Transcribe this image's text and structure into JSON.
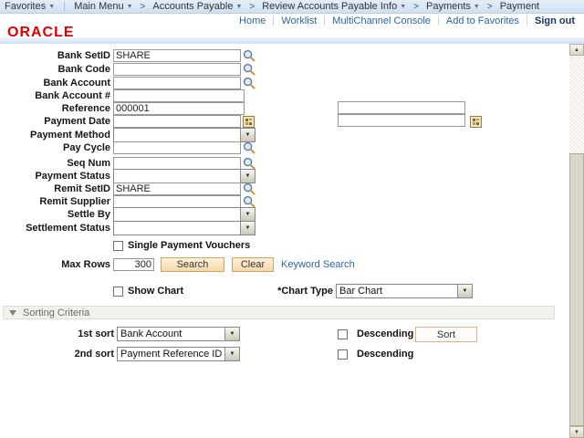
{
  "chrome": {
    "breadcrumb": {
      "favorites": "Favorites",
      "main_menu": "Main Menu",
      "separator": ">",
      "trail": [
        "Accounts Payable",
        "Review Accounts Payable Info",
        "Payments",
        "Payment"
      ]
    },
    "links": {
      "home": "Home",
      "worklist": "Worklist",
      "multichannel": "MultiChannel Console",
      "add_to_favorites": "Add to Favorites",
      "sign_out": "Sign out"
    },
    "logo": "ORACLE",
    "colors": {
      "logo_red": "#e00000",
      "link_blue": "#2d64a0",
      "button_tan": "#f6d9a9",
      "topbar_blue": "#d7e5f3"
    }
  },
  "form": {
    "bank_setid": {
      "label": "Bank SetID",
      "value": "SHARE"
    },
    "bank_code": {
      "label": "Bank Code",
      "value": ""
    },
    "bank_account": {
      "label": "Bank Account",
      "value": ""
    },
    "bank_account_num": {
      "label": "Bank Account #",
      "value": ""
    },
    "reference": {
      "label": "Reference",
      "value": "000001",
      "to_value": ""
    },
    "payment_date": {
      "label": "Payment Date",
      "value": "",
      "to_value": ""
    },
    "payment_method": {
      "label": "Payment Method",
      "value": ""
    },
    "pay_cycle": {
      "label": "Pay Cycle",
      "value": ""
    },
    "seq_num": {
      "label": "Seq Num",
      "value": ""
    },
    "payment_status": {
      "label": "Payment Status",
      "value": ""
    },
    "remit_setid": {
      "label": "Remit SetID",
      "value": "SHARE"
    },
    "remit_supplier": {
      "label": "Remit Supplier",
      "value": ""
    },
    "settle_by": {
      "label": "Settle By",
      "value": ""
    },
    "settlement_status": {
      "label": "Settlement Status",
      "value": ""
    },
    "single_payment_vouchers": {
      "label": "Single Payment Vouchers",
      "checked": false
    },
    "max_rows": {
      "label": "Max Rows",
      "value": "300"
    },
    "search_button": "Search",
    "clear_button": "Clear",
    "keyword_search_link": "Keyword Search",
    "show_chart": {
      "label": "Show Chart",
      "checked": false
    },
    "chart_type": {
      "label": "*Chart Type",
      "value": "Bar Chart"
    }
  },
  "sorting": {
    "title": "Sorting Criteria",
    "first": {
      "label": "1st sort",
      "value": "Bank Account",
      "descending_label": "Descending",
      "descending_checked": false
    },
    "second": {
      "label": "2nd sort",
      "value": "Payment Reference ID",
      "descending_label": "Descending",
      "descending_checked": false
    },
    "sort_button": "Sort"
  }
}
